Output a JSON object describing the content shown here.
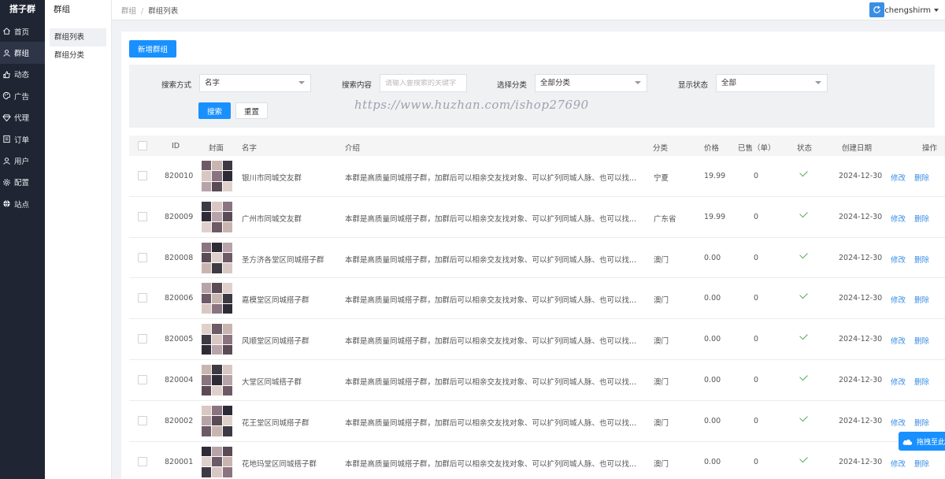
{
  "nav": {
    "brand": "搭子群",
    "items": [
      {
        "label": "首页",
        "icon": "home-icon"
      },
      {
        "label": "群组",
        "icon": "user-icon",
        "active": true
      },
      {
        "label": "动态",
        "icon": "thumb-icon"
      },
      {
        "label": "广告",
        "icon": "palette-icon"
      },
      {
        "label": "代理",
        "icon": "diamond-icon"
      },
      {
        "label": "订单",
        "icon": "order-icon"
      },
      {
        "label": "用户",
        "icon": "person-icon"
      },
      {
        "label": "配置",
        "icon": "gear-icon"
      },
      {
        "label": "站点",
        "icon": "globe-icon"
      }
    ]
  },
  "subnav": {
    "title": "群组",
    "items": [
      {
        "label": "群组列表",
        "active": true
      },
      {
        "label": "群组分类"
      }
    ]
  },
  "header": {
    "breadcrumb": [
      "群组",
      "群组列表"
    ],
    "username": "chengshirm"
  },
  "toolbar": {
    "add_label": "新增群组"
  },
  "search": {
    "method_label": "搜索方式",
    "method_value": "名字",
    "content_label": "搜索内容",
    "content_placeholder": "请输入要搜索的关键字",
    "category_label": "选择分类",
    "category_value": "全部分类",
    "status_label": "显示状态",
    "status_value": "全部",
    "search_button": "搜索",
    "reset_button": "重置"
  },
  "watermark": "https://www.huzhan.com/ishop27690",
  "table": {
    "columns": [
      "ID",
      "封面",
      "名字",
      "介绍",
      "分类",
      "价格",
      "已售（单）",
      "状态",
      "创建日期",
      "操作"
    ],
    "edit_label": "修改",
    "delete_label": "删除",
    "rows": [
      {
        "id": "820010",
        "name": "银川市同城交友群",
        "intro": "本群是高质量同城搭子群，加群后可以相亲交友找对象、可以扩列同城人脉、也可以找...",
        "category": "宁夏",
        "price": "19.99",
        "sold": "0",
        "date": "2024-12-30"
      },
      {
        "id": "820009",
        "name": "广州市同城交友群",
        "intro": "本群是高质量同城搭子群，加群后可以相亲交友找对象、可以扩列同城人脉、也可以找...",
        "category": "广东省",
        "price": "19.99",
        "sold": "0",
        "date": "2024-12-30"
      },
      {
        "id": "820008",
        "name": "圣方济各堂区同城搭子群",
        "intro": "本群是高质量同城搭子群，加群后可以相亲交友找对象、可以扩列同城人脉、也可以找...",
        "category": "澳门",
        "price": "0.00",
        "sold": "0",
        "date": "2024-12-30"
      },
      {
        "id": "820006",
        "name": "嘉模堂区同城搭子群",
        "intro": "本群是高质量同城搭子群，加群后可以相亲交友找对象、可以扩列同城人脉、也可以找...",
        "category": "澳门",
        "price": "0.00",
        "sold": "0",
        "date": "2024-12-30"
      },
      {
        "id": "820005",
        "name": "风顺堂区同城搭子群",
        "intro": "本群是高质量同城搭子群，加群后可以相亲交友找对象、可以扩列同城人脉、也可以找...",
        "category": "澳门",
        "price": "0.00",
        "sold": "0",
        "date": "2024-12-30"
      },
      {
        "id": "820004",
        "name": "大堂区同城搭子群",
        "intro": "本群是高质量同城搭子群，加群后可以相亲交友找对象、可以扩列同城人脉、也可以找...",
        "category": "澳门",
        "price": "0.00",
        "sold": "0",
        "date": "2024-12-30"
      },
      {
        "id": "820002",
        "name": "花王堂区同城搭子群",
        "intro": "本群是高质量同城搭子群，加群后可以相亲交友找对象、可以扩列同城人脉、也可以找...",
        "category": "澳门",
        "price": "0.00",
        "sold": "0",
        "date": "2024-12-30"
      },
      {
        "id": "820001",
        "name": "花地玛堂区同城搭子群",
        "intro": "本群是高质量同城搭子群，加群后可以相亲交友找对象、可以扩列同城人脉、也可以找...",
        "category": "澳门",
        "price": "0.00",
        "sold": "0",
        "date": "2024-12-30"
      }
    ]
  },
  "float_button": "拖拽至此",
  "colors": {
    "primary": "#1890ff",
    "nav_bg": "#1f2533",
    "link": "#3a8ee6",
    "check": "#52a65a"
  }
}
